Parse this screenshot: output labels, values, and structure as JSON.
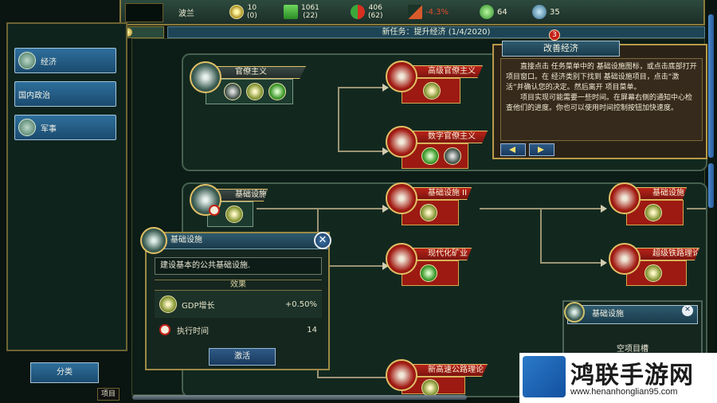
{
  "topbar": {
    "nation": "波兰",
    "star_top": "10",
    "star_bottom": "(0)",
    "money_top": "1061",
    "money_bottom": "(22)",
    "cycle_top": "406",
    "cycle_bottom": "(62)",
    "gdp": "-4.3%",
    "leaf": "64",
    "pop": "35"
  },
  "task": {
    "text": "新任务：提升经济 (1/4/2020)"
  },
  "sidebar": {
    "items": [
      {
        "label": "经济",
        "icon": "economy-icon"
      },
      {
        "label": "国内政治",
        "icon": ""
      },
      {
        "label": "军事",
        "icon": "military-icon"
      }
    ],
    "sort_label": "分类",
    "project_tab": "项目"
  },
  "tree": {
    "nodes": {
      "bureaucracy": "官僚主义",
      "adv_bureaucracy": "高级官僚主义",
      "digital_bureaucracy": "数字官僚主义",
      "infrastructure": "基础设施",
      "infrastructure_2": "基础设施 II",
      "infrastructure_3": "基础设施 III",
      "modern_mining": "现代化矿业",
      "super_rail": "超级铁路理论",
      "highway": "新高速公路理论"
    }
  },
  "tooltip": {
    "title": "基础设施",
    "description": "建设基本的公共基础设施.",
    "effect_label": "效果",
    "gdp_label": "GDP增长",
    "gdp_value": "+0.50%",
    "time_label": "执行时间",
    "time_value": "14",
    "activate_label": "激活"
  },
  "improve": {
    "title": "改善经济",
    "badge": "3",
    "p1": "直接点击 任务菜单中的 基础设施图标，或点击底部打开 项目窗口。在 经济类别下找到 基础设施项目，点击“激活”并确认您的决定。然后离开 项目菜单。",
    "p2": "项目实现可能需要一些时间。在屏幕右侧的通知中心检查他们的进度。你也可以使用时间控制按钮加快速度。"
  },
  "project_panel": {
    "title": "基础设施",
    "empty": "空项目槽"
  },
  "watermark": {
    "title": "鸿联手游网",
    "url": "www.henanhonglian95.com"
  },
  "colors": {
    "accent_red": "#b82218",
    "accent_blue": "#2e6f9c",
    "gold": "#e2c066"
  }
}
